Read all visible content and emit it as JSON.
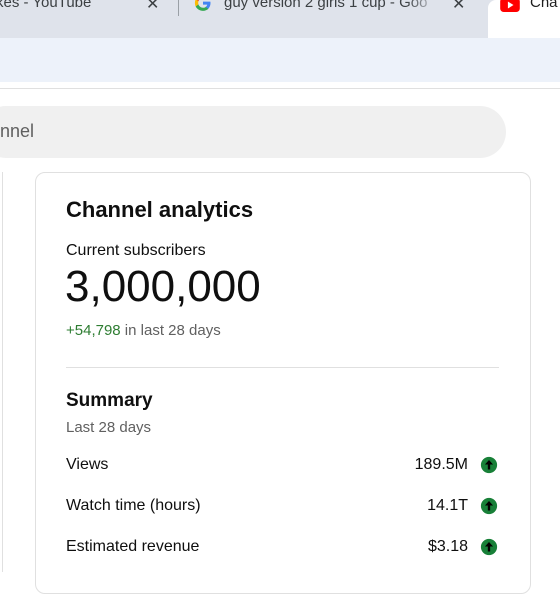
{
  "browser": {
    "tabs": [
      {
        "title": "kes - YouTube",
        "close": "✕"
      },
      {
        "title": "guy version 2 girls 1 cup - Goo",
        "close": "✕"
      },
      {
        "title": "Cha"
      }
    ]
  },
  "search": {
    "value": "nnel"
  },
  "analytics": {
    "title": "Channel analytics",
    "subscribers_label": "Current subscribers",
    "subscribers_count": "3,000,000",
    "subscribers_delta": "+54,798",
    "subscribers_period": " in last 28 days",
    "summary_title": "Summary",
    "summary_period": "Last 28 days",
    "metrics": [
      {
        "label": "Views",
        "value": "189.5M"
      },
      {
        "label": "Watch time (hours)",
        "value": "14.1T"
      },
      {
        "label": "Estimated revenue",
        "value": "$3.18"
      }
    ]
  },
  "colors": {
    "positive": "#2e7d32",
    "up_icon": "#188038",
    "yt_red": "#ff0000"
  }
}
